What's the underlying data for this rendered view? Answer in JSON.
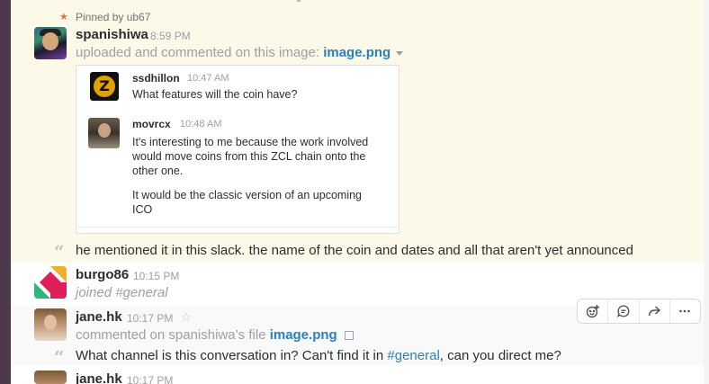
{
  "pinned": {
    "label": "Pinned by ub67"
  },
  "post": {
    "username": "spanishiwa",
    "time": "8:59 PM",
    "action_text": "uploaded and commented on this image:",
    "file_name": "image.png",
    "card": {
      "msg1": {
        "username": "ssdhillon",
        "time": "10:47 AM",
        "text": "What features will the coin have?"
      },
      "msg2": {
        "username": "movrcx",
        "time": "10:48 AM",
        "text_lines": [
          "It's interesting to me because the work involved",
          "would move coins from this ZCL chain onto the",
          "other one.",
          "It would be the classic version of an upcoming",
          "ICO"
        ]
      }
    },
    "comment": "he mentioned it in this slack. the name of the coin and dates and all that aren't yet announced"
  },
  "burgo": {
    "username": "burgo86",
    "time": "10:15 PM",
    "text": "joined #general"
  },
  "jane": {
    "username": "jane.hk",
    "time": "10:17 PM",
    "action_text": "commented on spanishiwa’s file",
    "file_name": "image.png",
    "comment_before": "What channel is this conversation in? Can't find it in ",
    "channel": "#general",
    "comment_after": ", can you direct me?"
  },
  "jane2": {
    "username": "jane.hk",
    "time": "10:17 PM"
  },
  "icons": {
    "pin": "pin-icon",
    "star": "star-icon",
    "quote": "quote-icon",
    "external": "external-link-icon"
  },
  "actions": [
    "add-reaction-icon",
    "start-thread-icon",
    "share-icon",
    "more-actions-icon"
  ],
  "colors": {
    "pinned_bg": "#fdf9e8",
    "link": "#2a80b9",
    "sidebar": "#4d394b",
    "pin": "#e8704a"
  }
}
